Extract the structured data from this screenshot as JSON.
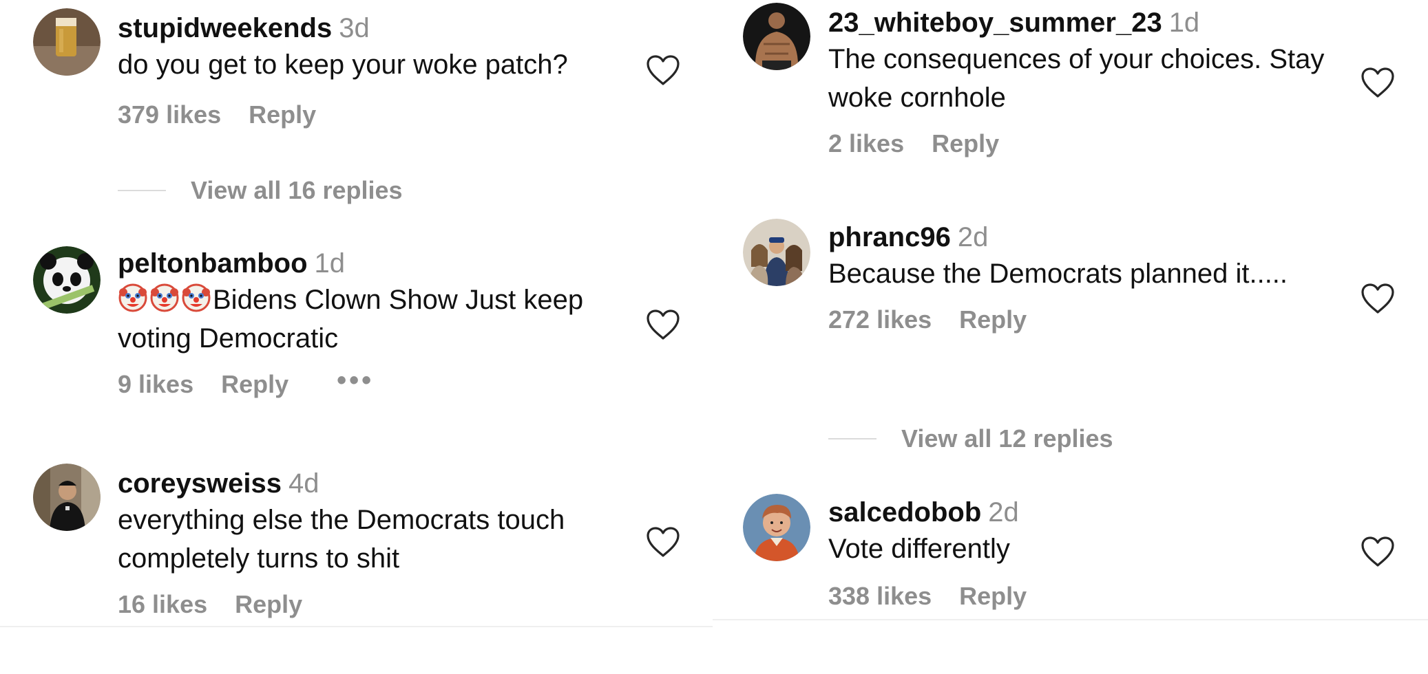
{
  "left_comments": [
    {
      "username": "stupidweekends",
      "time": "3d",
      "text": "do you get to keep your woke patch?",
      "likes": "379 likes",
      "reply_label": "Reply",
      "view_replies": "View all 16 replies"
    },
    {
      "username": "peltonbamboo",
      "time": "1d",
      "emoji": "clown-face",
      "text": "Bidens Clown Show Just keep voting Democratic",
      "likes": "9 likes",
      "reply_label": "Reply",
      "more_label": "•••"
    },
    {
      "username": "coreysweiss",
      "time": "4d",
      "text": "everything else the Democrats touch completely turns to shit",
      "likes": "16 likes",
      "reply_label": "Reply"
    }
  ],
  "right_comments": [
    {
      "username": "23_whiteboy_summer_23",
      "time": "1d",
      "text": "The consequences of your choices. Stay woke cornhole",
      "likes": "2 likes",
      "reply_label": "Reply"
    },
    {
      "username": "phranc96",
      "time": "2d",
      "text": "Because the Democrats planned it.....",
      "likes": "272 likes",
      "reply_label": "Reply",
      "view_replies": "View all 12 replies"
    },
    {
      "username": "salcedobob",
      "time": "2d",
      "text": "Vote differently",
      "likes": "338 likes",
      "reply_label": "Reply"
    }
  ],
  "colors": {
    "text": "#111111",
    "muted": "#8e8e8e",
    "divider": "#dbdbdb"
  },
  "icons": {
    "like": "heart-outline-icon",
    "clown": "clown-face-emoji"
  }
}
